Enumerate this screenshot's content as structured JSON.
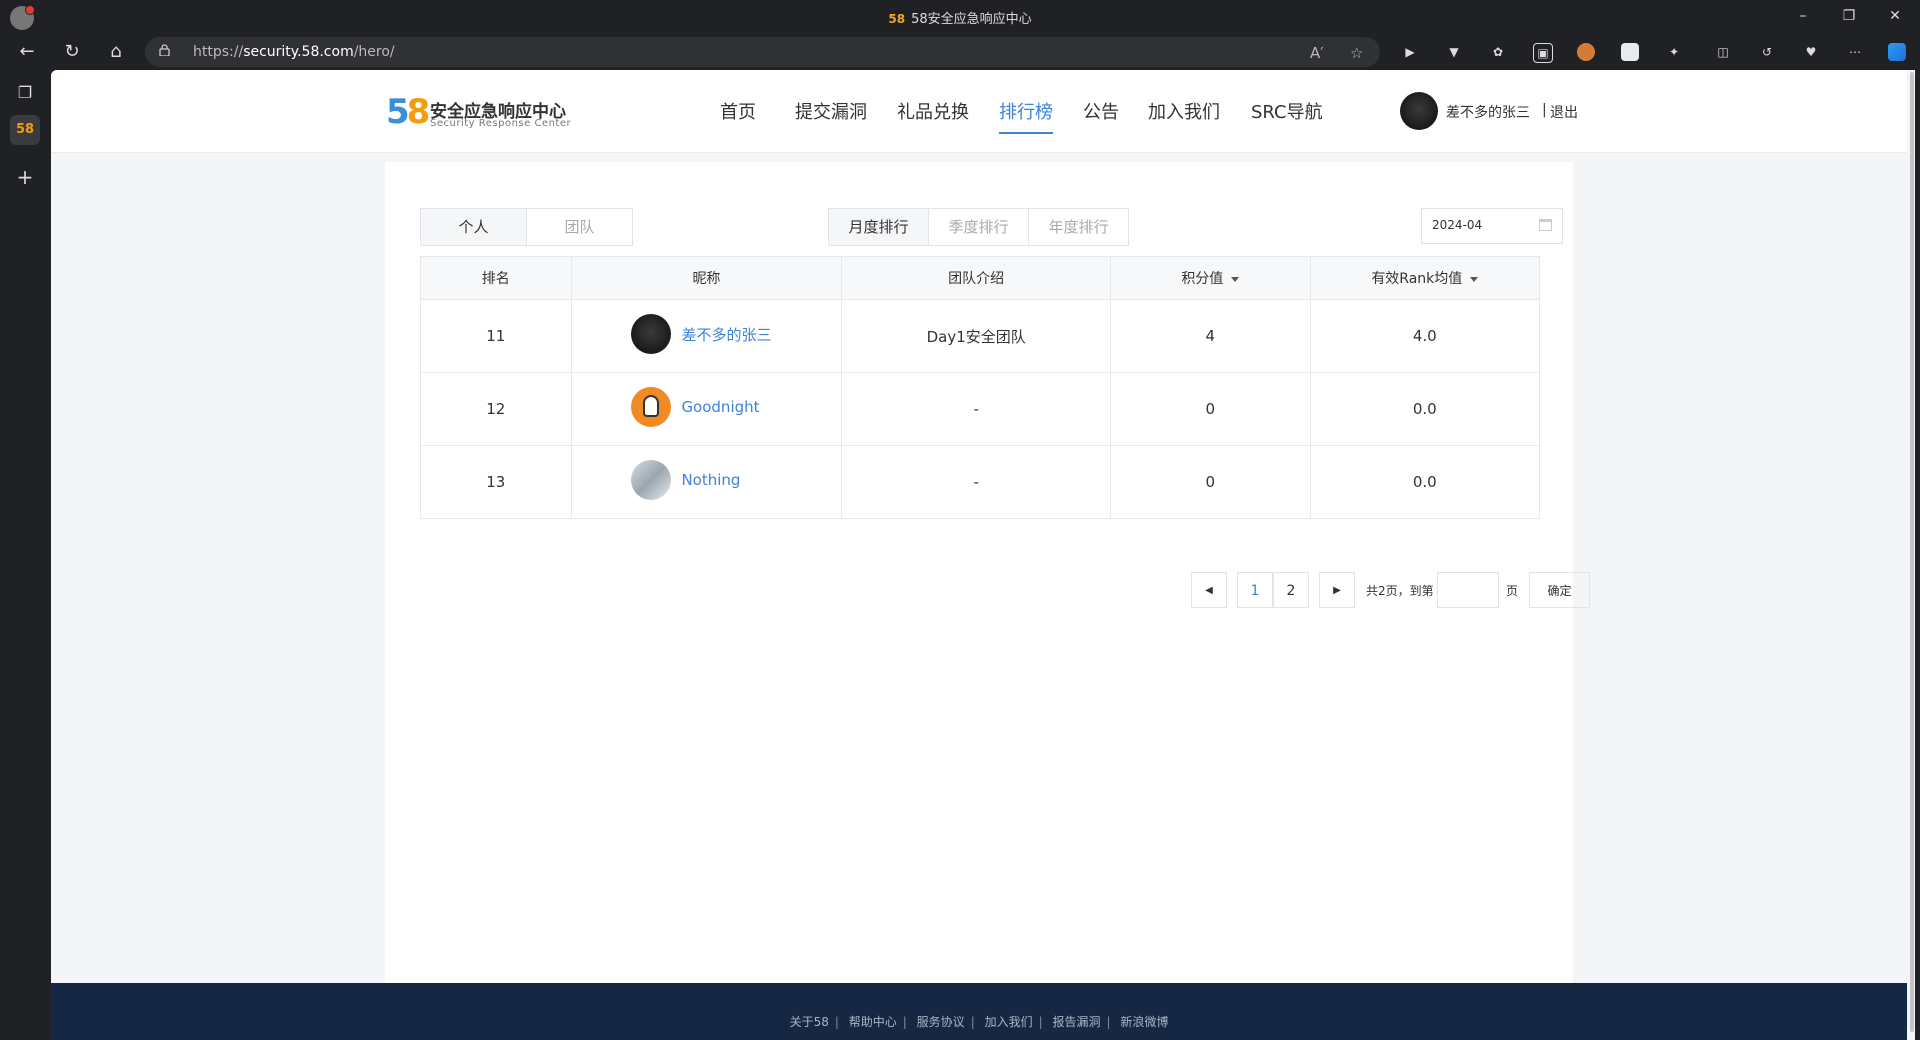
{
  "browser": {
    "tab_title": "58安全应急响应中心",
    "tab_favicon": "58",
    "url_prefix": "https://",
    "url_host": "security.58.com",
    "url_path": "/hero/",
    "window_controls": [
      "minimize-icon",
      "restore-icon",
      "close-icon"
    ]
  },
  "site": {
    "logo_number_a": "5",
    "logo_number_b": "8",
    "logo_cn": "安全应急响应中心",
    "logo_en": "Security Response Center",
    "nav": [
      "首页",
      "提交漏洞",
      "礼品兑换",
      "排行榜",
      "公告",
      "加入我们",
      "SRC导航"
    ],
    "nav_active": "排行榜",
    "user_name": "差不多的张三",
    "separator": "|",
    "logout": "退出"
  },
  "ranking": {
    "scope_tabs": [
      "个人",
      "团队"
    ],
    "scope_active": "个人",
    "period_tabs": [
      "月度排行",
      "季度排行",
      "年度排行"
    ],
    "period_active": "月度排行",
    "date_value": "2024-04",
    "columns": [
      "排名",
      "昵称",
      "团队介绍",
      "积分值",
      "有效Rank均值"
    ],
    "rows": [
      {
        "rank": "11",
        "nickname": "差不多的张三",
        "team": "Day1安全团队",
        "score": "4",
        "avg_rank": "4.0",
        "avatar": "dark-avatar"
      },
      {
        "rank": "12",
        "nickname": "Goodnight",
        "team": "-",
        "score": "0",
        "avg_rank": "0.0",
        "avatar": "orange-avatar"
      },
      {
        "rank": "13",
        "nickname": "Nothing",
        "team": "-",
        "score": "0",
        "avg_rank": "0.0",
        "avatar": "photo-avatar"
      }
    ]
  },
  "pagination": {
    "pages": [
      "1",
      "2"
    ],
    "current": "1",
    "total_text": "共2页，到第",
    "page_suffix": "页",
    "confirm": "确定"
  },
  "footer": {
    "links": [
      "关于58",
      "帮助中心",
      "服务协议",
      "加入我们",
      "报告漏洞",
      "新浪微博"
    ],
    "separator": "|"
  },
  "colors": {
    "accent": "#3d83d8",
    "footer_bg": "#162744",
    "browser_bg": "#202124"
  }
}
